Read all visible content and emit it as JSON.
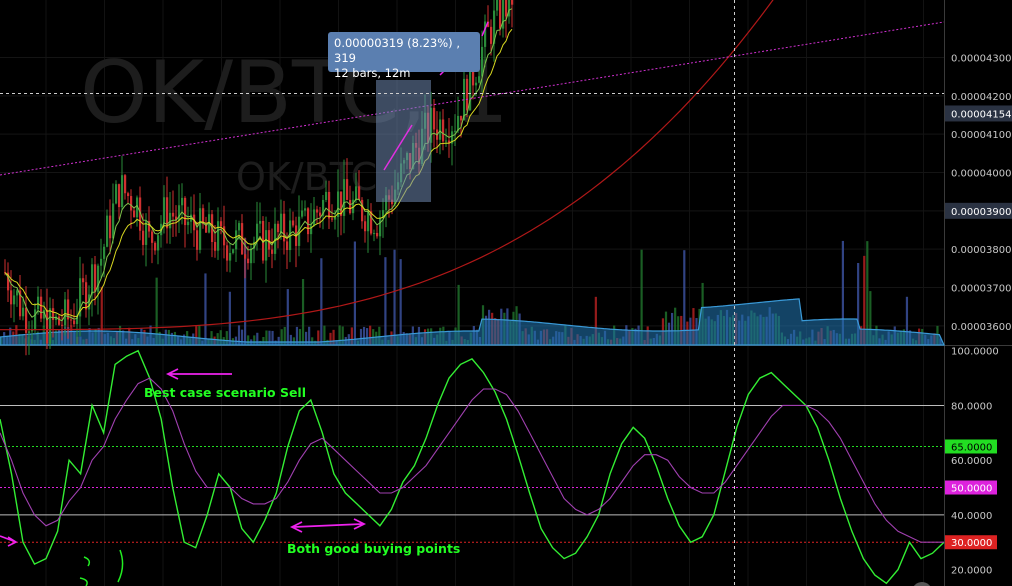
{
  "chart_data": [
    {
      "type": "candlestick",
      "watermark": "OK/BTC, 1",
      "watermark_small": "OK/BTC",
      "price_axis": {
        "ticks": [
          "0.00004300",
          "0.00004200",
          "0.00004100",
          "0.00004000",
          "0.00003900",
          "0.00003800",
          "0.00003700",
          "0.00003600"
        ],
        "ylim": [
          3.55e-05,
          4.45e-05
        ]
      },
      "current_price_label": "0.00004154",
      "range_low_label": "0.00003900",
      "measure_tooltip": {
        "line1": "0.00000319 (8.23%) , 319",
        "line2": "12 bars, 12m"
      },
      "colors": {
        "up": "#2a8c3a",
        "down": "#d03030",
        "ema_fast": "#7fc24a",
        "ema_slow": "#d8d820",
        "ma_long": "#b01818",
        "trendline": "#d030d0",
        "volume_area": "#1f6fa8"
      }
    },
    {
      "type": "line",
      "indicator": "Stochastic RSI",
      "axis_ticks": [
        "100.0000",
        "80.0000",
        "60.0000",
        "40.0000",
        "20.0000"
      ],
      "ylim": [
        14,
        101
      ],
      "levels": [
        {
          "label": "65.0000",
          "value": 65,
          "color": "#22dd22"
        },
        {
          "label": "50.0000",
          "value": 50,
          "color": "#dd22dd"
        },
        {
          "label": "30.0000",
          "value": 30,
          "color": "#dd2222"
        }
      ],
      "series": [
        {
          "color": "#33ee33",
          "values": [
            75,
            55,
            30,
            22,
            24,
            34,
            60,
            55,
            80,
            70,
            95,
            98,
            100,
            90,
            75,
            50,
            30,
            28,
            40,
            55,
            50,
            35,
            30,
            38,
            48,
            65,
            78,
            82,
            70,
            55,
            48,
            44,
            40,
            36,
            42,
            52,
            58,
            68,
            80,
            90,
            95,
            97,
            92,
            85,
            75,
            62,
            48,
            35,
            28,
            24,
            26,
            32,
            40,
            55,
            66,
            72,
            68,
            58,
            46,
            36,
            30,
            32,
            40,
            56,
            72,
            84,
            90,
            92,
            88,
            84,
            80,
            72,
            60,
            46,
            34,
            24,
            18,
            15,
            20,
            30,
            24,
            26,
            30
          ]
        },
        {
          "color": "#a040b0",
          "values": [
            70,
            60,
            48,
            40,
            36,
            38,
            45,
            50,
            60,
            65,
            75,
            82,
            88,
            90,
            86,
            78,
            66,
            56,
            50,
            50,
            50,
            46,
            44,
            44,
            46,
            52,
            60,
            66,
            68,
            64,
            60,
            56,
            52,
            48,
            48,
            50,
            54,
            58,
            64,
            70,
            76,
            82,
            86,
            86,
            84,
            78,
            70,
            62,
            54,
            46,
            42,
            40,
            42,
            46,
            52,
            58,
            62,
            62,
            60,
            54,
            50,
            48,
            48,
            52,
            58,
            64,
            70,
            76,
            80,
            80,
            80,
            78,
            74,
            68,
            60,
            52,
            44,
            38,
            34,
            32,
            30,
            30,
            30
          ]
        }
      ]
    }
  ],
  "annotations": {
    "sell": "Best case scenario Sell",
    "buy": "Both good buying points"
  }
}
